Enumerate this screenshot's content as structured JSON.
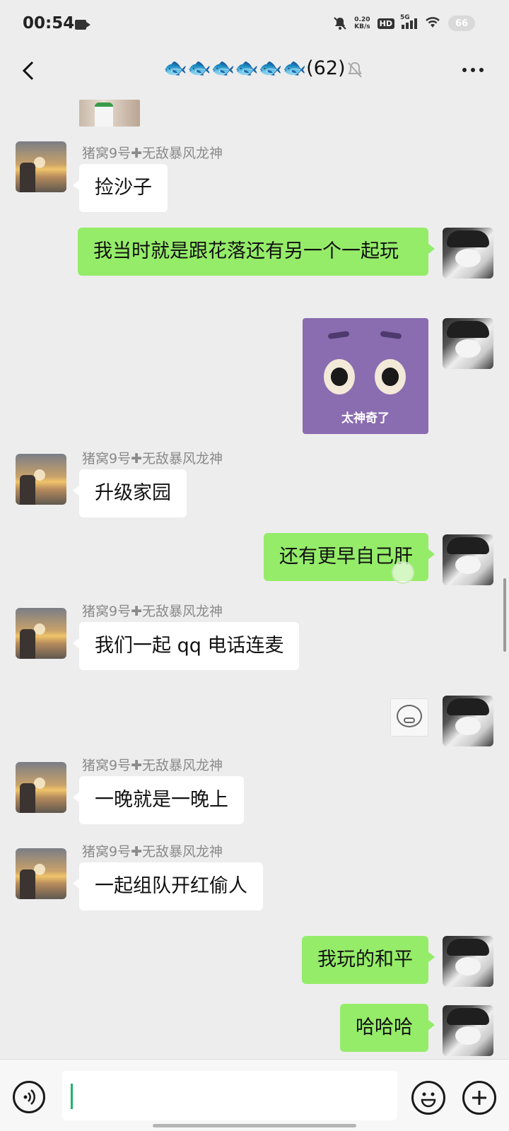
{
  "status_bar": {
    "time": "00:54",
    "net_speed_value": "0.20",
    "net_speed_unit": "KB/s",
    "hd_badge": "HD",
    "network_type": "5G",
    "battery": "66"
  },
  "nav": {
    "title": "🐟🐟🐟🐟🐟🐟(62)"
  },
  "messages": [
    {
      "side": "left",
      "sender": "猪窝9号✚无敌暴风龙神",
      "text": "捡沙子"
    },
    {
      "side": "right",
      "text": "我当时就是跟花落还有另一个一起玩"
    },
    {
      "side": "right",
      "type": "sticker",
      "caption": "太神奇了"
    },
    {
      "side": "left",
      "sender": "猪窝9号✚无敌暴风龙神",
      "text": "升级家园"
    },
    {
      "side": "right",
      "text": "还有更早自己肝"
    },
    {
      "side": "left",
      "sender": "猪窝9号✚无敌暴风龙神",
      "text": "我们一起 qq 电话连麦"
    },
    {
      "side": "right",
      "type": "sticker"
    },
    {
      "side": "left",
      "sender": "猪窝9号✚无敌暴风龙神",
      "text": "一晚就是一晚上"
    },
    {
      "side": "left",
      "sender": "猪窝9号✚无敌暴风龙神",
      "text": "一起组队开红偷人"
    },
    {
      "side": "right",
      "text": "我玩的和平"
    },
    {
      "side": "right",
      "text": "哈哈哈"
    }
  ],
  "input_bar": {
    "input_value": "",
    "icons": [
      "voice-icon",
      "emoji-icon",
      "add-icon"
    ]
  },
  "colors": {
    "background": "#ededed",
    "bubble_sent": "#95ec69",
    "bubble_received": "#ffffff",
    "sender_name": "#8a8a8a",
    "cursor": "#21b36b"
  }
}
